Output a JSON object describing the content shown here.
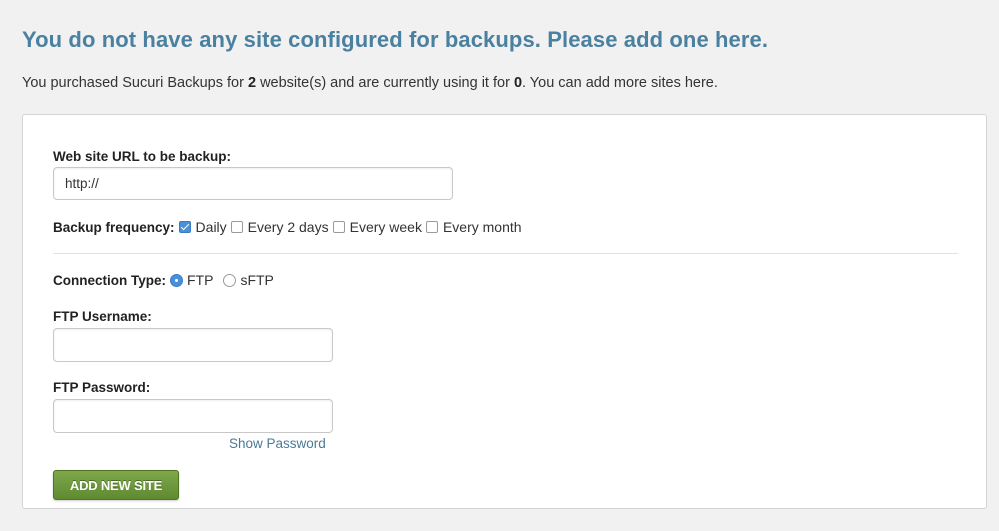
{
  "heading": "You do not have any site configured for backups. Please add one here.",
  "summary": {
    "prefix": "You purchased Sucuri Backups for ",
    "purchased_count": "2",
    "middle": " website(s) and are currently using it for ",
    "used_count": "0",
    "suffix": ". You can add more sites here."
  },
  "form": {
    "url_label": "Web site URL to be backup:",
    "url_value": "http://",
    "frequency": {
      "label": "Backup frequency:",
      "options": [
        {
          "label": "Daily",
          "checked": true
        },
        {
          "label": "Every 2 days",
          "checked": false
        },
        {
          "label": "Every week",
          "checked": false
        },
        {
          "label": "Every month",
          "checked": false
        }
      ]
    },
    "connection": {
      "label": "Connection Type:",
      "options": [
        {
          "label": "FTP",
          "checked": true
        },
        {
          "label": "sFTP",
          "checked": false
        }
      ]
    },
    "username_label": "FTP Username:",
    "username_value": "",
    "password_label": "FTP Password:",
    "password_value": "",
    "show_password": "Show Password",
    "submit_label": "ADD NEW SITE"
  },
  "colors": {
    "heading": "#4a80a0",
    "link": "#4a7a96",
    "button": "#6d9a3c",
    "checked_control": "#4a90d9",
    "background": "#f1f1f1"
  }
}
